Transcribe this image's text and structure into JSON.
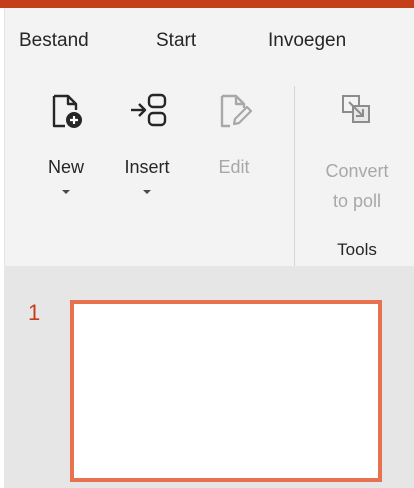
{
  "tabs": [
    "Bestand",
    "Start",
    "Invoegen"
  ],
  "buttons": {
    "new": {
      "label": "New",
      "icon": "new-document-icon"
    },
    "insert": {
      "label": "Insert",
      "icon": "insert-icon"
    },
    "edit": {
      "label": "Edit",
      "icon": "edit-icon"
    },
    "convert": {
      "label_line1": "Convert",
      "label_line2": "to poll",
      "icon": "convert-icon"
    }
  },
  "groups": {
    "tools": "Tools"
  },
  "slides": [
    {
      "number": "1"
    }
  ],
  "colors": {
    "accent": "#c43e1c",
    "slide_border": "#e8714f",
    "disabled_text": "#a8a8a8"
  }
}
